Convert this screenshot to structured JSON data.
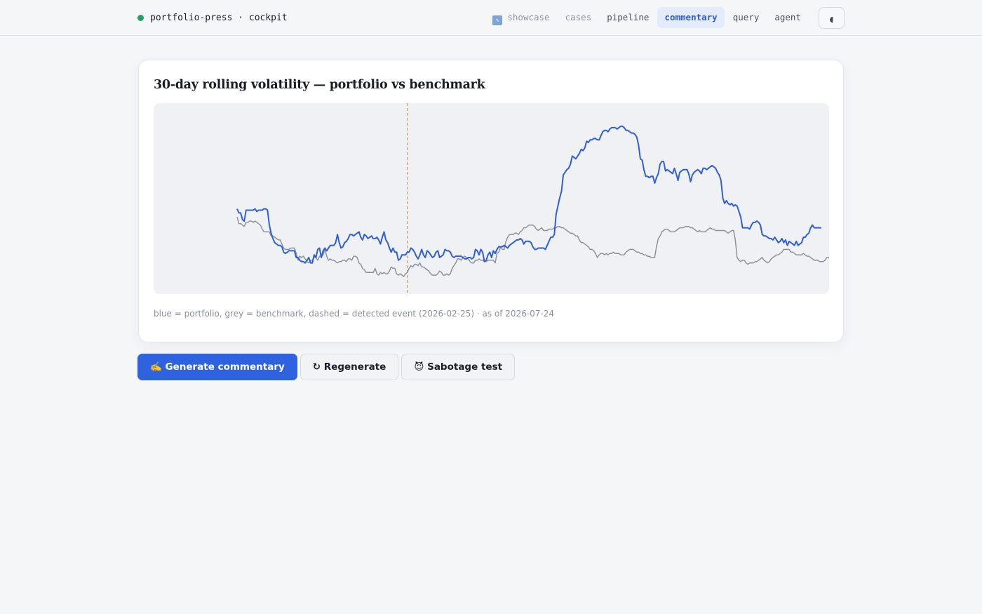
{
  "header": {
    "brand": "portfolio-press · cockpit",
    "status_color": "#22a06b",
    "nav": [
      {
        "label": "showcase",
        "icon": "pointer-arrow-icon",
        "state": "muted"
      },
      {
        "label": "cases",
        "state": "muted"
      },
      {
        "label": "pipeline",
        "state": "normal"
      },
      {
        "label": "commentary",
        "state": "active"
      },
      {
        "label": "query",
        "state": "normal"
      },
      {
        "label": "agent",
        "state": "normal"
      }
    ],
    "mode_button_glyph": "◖"
  },
  "card": {
    "title": "30-day rolling volatility — portfolio vs benchmark",
    "caption": "blue = portfolio, grey = benchmark, dashed = detected event (2026-02-25) · as of 2026-07-24"
  },
  "chart_data": {
    "type": "line",
    "title": "30-day rolling volatility — portfolio vs benchmark",
    "xlabel": "",
    "ylabel": "",
    "grid": false,
    "event_index": 95,
    "event_color": "#c7893a",
    "series": [
      {
        "name": "portfolio",
        "color": "#2f5fd8",
        "values": [
          0.34,
          0.31,
          0.31,
          0.26,
          0.25,
          0.33,
          0.33,
          0.33,
          0.33,
          0.33,
          0.34,
          0.32,
          0.33,
          0.33,
          0.33,
          0.34,
          0.34,
          0.33,
          0.22,
          0.16,
          0.12,
          0.09,
          0.08,
          0.07,
          0.07,
          0.06,
          0.02,
          0.01,
          0.02,
          0.03,
          0.03,
          0.03,
          0.03,
          -0.02,
          -0.02,
          -0.04,
          -0.05,
          -0.05,
          -0.06,
          -0.04,
          -0.02,
          -0.06,
          -0.06,
          0.0,
          -0.02,
          0.04,
          0.05,
          -0.02,
          0.03,
          0.05,
          0.03,
          0.05,
          0.07,
          0.07,
          0.07,
          0.09,
          0.15,
          0.09,
          0.05,
          0.06,
          0.09,
          0.1,
          0.12,
          0.15,
          0.15,
          0.14,
          0.15,
          0.16,
          0.17,
          0.13,
          0.11,
          0.15,
          0.14,
          0.12,
          0.13,
          0.14,
          0.12,
          0.12,
          0.13,
          0.11,
          0.08,
          0.13,
          0.17,
          0.11,
          0.09,
          0.05,
          0.02,
          0.05,
          0.02,
          0.02,
          -0.04,
          -0.03,
          0.0,
          0.0,
          0.0,
          0.02,
          0.02,
          0.05,
          0.04,
          0.02,
          -0.01,
          -0.03,
          0.0,
          0.04,
          0.0,
          -0.02,
          0.03,
          0.02,
          0.0,
          -0.02,
          -0.01,
          0.02,
          0.03,
          -0.02,
          -0.01,
          0.0,
          0.04,
          0.03,
          0.03,
          0.02,
          -0.01,
          -0.02,
          -0.01,
          -0.01,
          -0.01,
          -0.01,
          -0.02,
          -0.03,
          -0.03,
          -0.02,
          -0.02,
          -0.03,
          -0.02,
          0.04,
          0.03,
          0.0,
          0.04,
          0.02,
          -0.05,
          -0.04,
          0.0,
          0.02,
          -0.02,
          0.03,
          0.01,
          0.04,
          0.06,
          0.06,
          0.06,
          0.07,
          0.06,
          0.05,
          0.07,
          0.08,
          0.09,
          0.1,
          0.11,
          0.11,
          0.12,
          0.11,
          0.08,
          0.1,
          0.1,
          0.1,
          0.09,
          0.06,
          0.04,
          0.04,
          0.05,
          0.05,
          0.05,
          0.05,
          0.04,
          0.07,
          0.1,
          0.13,
          0.13,
          0.15,
          0.3,
          0.36,
          0.42,
          0.47,
          0.59,
          0.61,
          0.63,
          0.64,
          0.67,
          0.73,
          0.72,
          0.71,
          0.73,
          0.75,
          0.78,
          0.77,
          0.79,
          0.84,
          0.83,
          0.85,
          0.85,
          0.86,
          0.86,
          0.85,
          0.85,
          0.88,
          0.91,
          0.92,
          0.92,
          0.91,
          0.93,
          0.94,
          0.94,
          0.94,
          0.93,
          0.94,
          0.95,
          0.95,
          0.94,
          0.92,
          0.92,
          0.91,
          0.9,
          0.9,
          0.89,
          0.87,
          0.81,
          0.71,
          0.7,
          0.63,
          0.58,
          0.58,
          0.57,
          0.58,
          0.58,
          0.53,
          0.57,
          0.6,
          0.67,
          0.69,
          0.69,
          0.62,
          0.63,
          0.62,
          0.61,
          0.6,
          0.64,
          0.6,
          0.55,
          0.61,
          0.62,
          0.63,
          0.63,
          0.63,
          0.6,
          0.54,
          0.59,
          0.61,
          0.62,
          0.63,
          0.62,
          0.6,
          0.64,
          0.64,
          0.63,
          0.64,
          0.65,
          0.66,
          0.65,
          0.64,
          0.61,
          0.59,
          0.55,
          0.42,
          0.38,
          0.4,
          0.38,
          0.37,
          0.38,
          0.36,
          0.37,
          0.36,
          0.32,
          0.28,
          0.2,
          0.2,
          0.2,
          0.2,
          0.19,
          0.22,
          0.24,
          0.24,
          0.25,
          0.24,
          0.22,
          0.15,
          0.14,
          0.14,
          0.13,
          0.12,
          0.12,
          0.11,
          0.13,
          0.11,
          0.09,
          0.1,
          0.12,
          0.09,
          0.11,
          0.07,
          0.1,
          0.09,
          0.08,
          0.07,
          0.1,
          0.07,
          0.08,
          0.09,
          0.13,
          0.13,
          0.15,
          0.16,
          0.2,
          0.22,
          0.2,
          0.2,
          0.2,
          0.2,
          0.2
        ]
      },
      {
        "name": "benchmark",
        "color": "#8d939d",
        "values": [
          0.28,
          0.23,
          0.23,
          0.22,
          0.21,
          0.24,
          0.24,
          0.25,
          0.25,
          0.24,
          0.25,
          0.24,
          0.23,
          0.22,
          0.19,
          0.17,
          0.17,
          0.17,
          0.17,
          0.14,
          0.14,
          0.13,
          0.12,
          0.11,
          0.11,
          0.08,
          0.05,
          0.04,
          0.04,
          0.04,
          0.05,
          0.05,
          0.05,
          0.01,
          -0.04,
          -0.01,
          -0.02,
          -0.01,
          -0.03,
          -0.05,
          -0.06,
          -0.04,
          -0.04,
          -0.02,
          -0.02,
          -0.04,
          -0.01,
          -0.01,
          0.0,
          0.04,
          -0.01,
          -0.04,
          -0.03,
          -0.04,
          -0.04,
          -0.05,
          -0.06,
          -0.05,
          -0.05,
          -0.04,
          -0.04,
          -0.05,
          -0.03,
          -0.03,
          -0.04,
          -0.01,
          -0.01,
          -0.02,
          -0.06,
          -0.07,
          -0.1,
          -0.11,
          -0.13,
          -0.13,
          -0.13,
          -0.13,
          -0.13,
          -0.1,
          -0.14,
          -0.15,
          -0.13,
          -0.14,
          -0.13,
          -0.14,
          -0.14,
          -0.12,
          -0.09,
          -0.1,
          -0.1,
          -0.14,
          -0.15,
          -0.14,
          -0.15,
          -0.16,
          -0.14,
          -0.13,
          -0.1,
          -0.08,
          -0.09,
          -0.07,
          -0.07,
          -0.08,
          -0.06,
          -0.09,
          -0.09,
          -0.1,
          -0.11,
          -0.12,
          -0.14,
          -0.15,
          -0.15,
          -0.15,
          -0.14,
          -0.12,
          -0.13,
          -0.15,
          -0.15,
          -0.14,
          -0.15,
          -0.14,
          -0.1,
          -0.08,
          -0.06,
          -0.03,
          -0.03,
          -0.04,
          -0.02,
          -0.01,
          -0.02,
          -0.03,
          -0.05,
          -0.06,
          -0.06,
          -0.04,
          -0.04,
          -0.03,
          -0.04,
          -0.04,
          -0.05,
          -0.05,
          -0.04,
          -0.04,
          -0.04,
          -0.04,
          -0.06,
          0.01,
          0.02,
          0.06,
          0.04,
          0.04,
          0.1,
          0.13,
          0.15,
          0.15,
          0.15,
          0.16,
          0.16,
          0.15,
          0.17,
          0.18,
          0.2,
          0.2,
          0.21,
          0.22,
          0.22,
          0.22,
          0.21,
          0.19,
          0.18,
          0.19,
          0.2,
          0.18,
          0.18,
          0.18,
          0.19,
          0.19,
          0.19,
          0.2,
          0.2,
          0.21,
          0.21,
          0.2,
          0.2,
          0.19,
          0.18,
          0.17,
          0.16,
          0.16,
          0.15,
          0.14,
          0.14,
          0.11,
          0.09,
          0.09,
          0.08,
          0.07,
          0.06,
          0.04,
          0.04,
          0.03,
          0.01,
          -0.02,
          0.0,
          0.01,
          0.01,
          0.0,
          0.01,
          0.0,
          0.01,
          0.01,
          0.02,
          0.01,
          0.01,
          0.01,
          0.0,
          0.0,
          0.0,
          0.02,
          0.03,
          0.04,
          0.04,
          0.04,
          0.03,
          0.02,
          0.02,
          0.01,
          0.01,
          0.0,
          0.0,
          -0.01,
          -0.01,
          -0.02,
          -0.02,
          -0.02,
          0.06,
          0.12,
          0.14,
          0.17,
          0.18,
          0.19,
          0.19,
          0.18,
          0.17,
          0.17,
          0.17,
          0.18,
          0.19,
          0.2,
          0.2,
          0.2,
          0.21,
          0.21,
          0.21,
          0.2,
          0.2,
          0.19,
          0.18,
          0.17,
          0.18,
          0.17,
          0.17,
          0.17,
          0.18,
          0.19,
          0.2,
          0.19,
          0.19,
          0.18,
          0.18,
          0.18,
          0.18,
          0.18,
          0.18,
          0.17,
          0.16,
          0.17,
          0.18,
          0.18,
          0.11,
          -0.02,
          -0.04,
          -0.05,
          -0.04,
          -0.04,
          -0.06,
          -0.07,
          -0.06,
          -0.06,
          -0.06,
          -0.05,
          -0.05,
          -0.04,
          -0.03,
          -0.02,
          -0.04,
          -0.05,
          -0.06,
          -0.05,
          -0.03,
          -0.02,
          -0.01,
          0.0,
          0.0,
          0.01,
          0.02,
          0.04,
          0.04,
          0.04,
          0.04,
          0.02,
          0.02,
          0.01,
          0.0,
          0.0,
          0.0,
          0.0,
          0.01,
          0.0,
          -0.01,
          -0.01,
          -0.02,
          -0.03,
          -0.04,
          -0.04,
          -0.04,
          -0.05,
          -0.05,
          -0.05,
          -0.04,
          -0.02,
          -0.02,
          -0.03,
          -0.04,
          -0.05
        ]
      }
    ]
  },
  "actions": {
    "generate": "✍️ Generate commentary",
    "regenerate": "↻ Regenerate",
    "sabotage": "😈 Sabotage test"
  }
}
